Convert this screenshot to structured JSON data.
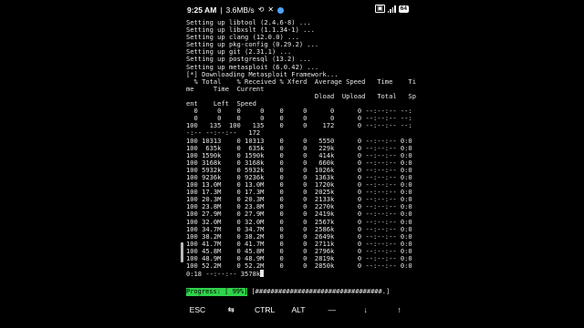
{
  "status_bar": {
    "time": "9:25 AM",
    "network_speed": "3.6MB/s",
    "battery": "64"
  },
  "terminal": {
    "lines": [
      "Setting up libtool (2.4.6-8) ...",
      "Setting up libxslt (1.1.34-1) ...",
      "Setting up clang (12.0.0) ...",
      "Setting up pkg-config (0.29.2) ...",
      "Setting up git (2.31.1) ...",
      "Setting up postgresql (13.2) ...",
      "Setting up metasploit (6.0.42) ...",
      "[*] Downloading Metasploit Framework...",
      "  % Total    % Received % Xferd  Average Speed   Time    Ti",
      "me     Time  Current",
      "                                 Dload  Upload   Total   Sp",
      "ent    Left  Speed",
      "  0     0    0     0    0     0      0      0 --:--:-- --:",
      "  0     0    0     0    0     0      0      0 --:--:-- --:",
      "100   135  100   135    0     0    172      0 --:--:-- --:",
      "-:-- --:--:--   172",
      "100 10313    0 10313    0     0   5550      0 --:--:-- 0:0",
      "100  635k    0  635k    0     0   229k      0 --:--:-- 0:0",
      "100 1590k    0 1590k    0     0   414k      0 --:--:-- 0:0",
      "100 3168k    0 3168k    0     0   660k      0 --:--:-- 0:0",
      "100 5932k    0 5932k    0     0  1026k      0 --:--:-- 0:0",
      "100 9236k    0 9236k    0     0  1363k      0 --:--:-- 0:0",
      "100 13.0M    0 13.0M    0     0  1720k      0 --:--:-- 0:0",
      "100 17.3M    0 17.3M    0     0  2025k      0 --:--:-- 0:0",
      "100 20.3M    0 20.3M    0     0  2133k      0 --:--:-- 0:0",
      "100 23.8M    0 23.8M    0     0  2270k      0 --:--:-- 0:0",
      "100 27.9M    0 27.9M    0     0  2419k      0 --:--:-- 0:0",
      "100 32.0M    0 32.0M    0     0  2567k      0 --:--:-- 0:0",
      "100 34.7M    0 34.7M    0     0  2586k      0 --:--:-- 0:0",
      "100 38.2M    0 38.2M    0     0  2649k      0 --:--:-- 0:0",
      "100 41.7M    0 41.7M    0     0  2711k      0 --:--:-- 0:0",
      "100 45.8M    0 45.8M    0     0  2796k      0 --:--:-- 0:0",
      "100 48.9M    0 48.9M    0     0  2819k      0 --:--:-- 0:0",
      "100 52.2M    0 52.2M    0     0  2850k      0 --:--:-- 0:0",
      "0:18 --:--:-- 3578k"
    ],
    "progress_label": "Progress: [ 99%]",
    "progress_bar": "[#################################.]"
  },
  "extra_keys": {
    "esc": "ESC",
    "tab": "⇆",
    "ctrl": "CTRL",
    "alt": "ALT",
    "dash": "—",
    "down": "↓",
    "up": "↑"
  },
  "colors": {
    "progress_accent": "#2fd44a",
    "background": "#000000"
  }
}
